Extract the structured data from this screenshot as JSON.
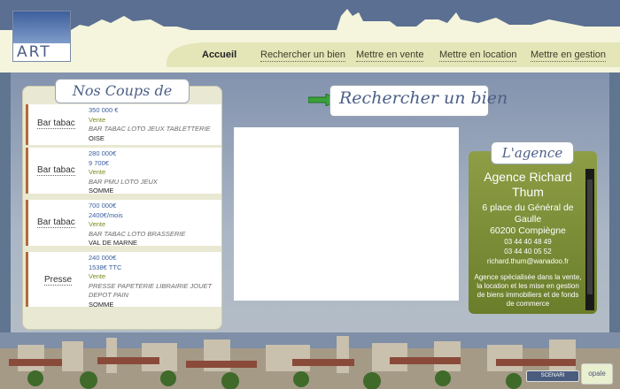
{
  "logo": {
    "text": "ART"
  },
  "nav": [
    "Accueil",
    "Rechercher un bien",
    "Mettre en vente",
    "Mettre en location",
    "Mettre en gestion"
  ],
  "coups_title": "Nos Coups de coeur",
  "listings": [
    {
      "category": "Bar tabac",
      "lines": [
        {
          "t": "350 000 €",
          "c": "price"
        },
        {
          "t": "Vente",
          "c": "vente"
        },
        {
          "t": "BAR TABAC LOTO JEUX TABLETTERIE",
          "c": "desc"
        },
        {
          "t": "OISE",
          "c": "loc"
        }
      ]
    },
    {
      "category": "Bar tabac",
      "lines": [
        {
          "t": "280 000€",
          "c": "price"
        },
        {
          "t": "9 700€",
          "c": "price"
        },
        {
          "t": "Vente",
          "c": "vente"
        },
        {
          "t": "BAR PMU LOTO JEUX",
          "c": "desc"
        },
        {
          "t": "SOMME",
          "c": "loc"
        }
      ]
    },
    {
      "category": "Bar tabac",
      "lines": [
        {
          "t": "700 000€",
          "c": "price"
        },
        {
          "t": "2400€/mois",
          "c": "price"
        },
        {
          "t": "Vente",
          "c": "vente"
        },
        {
          "t": "BAR TABAC LOTO BRASSERIE",
          "c": "desc"
        },
        {
          "t": "VAL DE MARNE",
          "c": "loc"
        }
      ]
    },
    {
      "category": "Presse",
      "lines": [
        {
          "t": "240 000€",
          "c": "price"
        },
        {
          "t": "1538€ TTC",
          "c": "price"
        },
        {
          "t": "Vente",
          "c": "vente"
        },
        {
          "t": "PRESSE PAPETERIE LIBRAIRIE JOUET DEPOT PAIN",
          "c": "desc"
        },
        {
          "t": "SOMME",
          "c": "loc"
        }
      ]
    }
  ],
  "search_label": "Rechercher un bien",
  "agence": {
    "title": "L'agence",
    "name": "Agence Richard Thum",
    "address": "6 place du Général de Gaulle",
    "city": "60200 Compiègne",
    "phone": "03 44 40 48 49",
    "fax": "03 44 40 05 52",
    "email": "richard.thum@wanadoo.fr",
    "description": "Agence spécialisée dans la vente, la location et les mise en gestion de biens immobiliers et de fonds de commerce"
  },
  "badges": {
    "scenari": "SCENARI",
    "opale": "opale"
  },
  "colors": {
    "accent": "#4c5f87",
    "agence_bg": "#7f9036",
    "listing_border": "#b06a3a"
  }
}
